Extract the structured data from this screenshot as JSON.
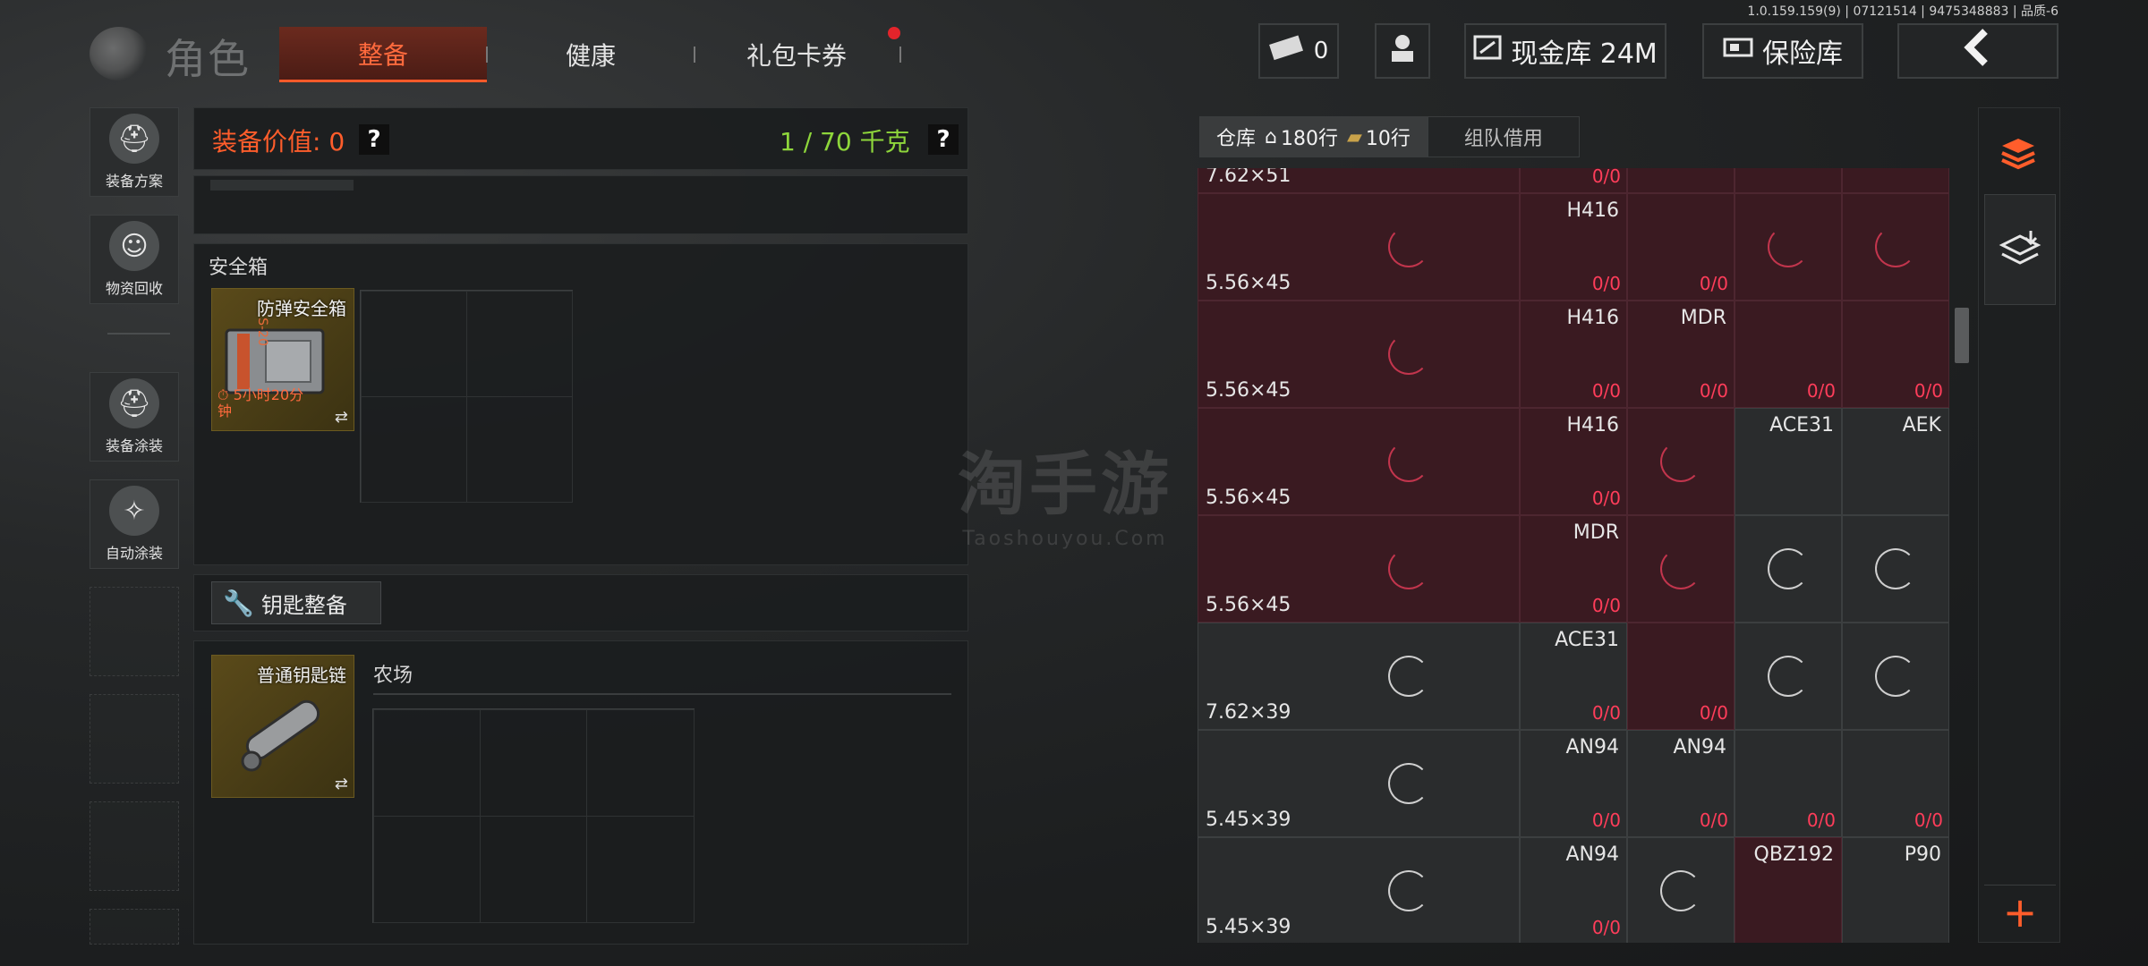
{
  "version": "1.0.159.159(9) | 07121514 | 9475348883 | 品质-6",
  "header": {
    "title": "角色",
    "tabs": [
      {
        "label": "整备",
        "active": true
      },
      {
        "label": "健康",
        "active": false
      },
      {
        "label": "礼包卡券",
        "active": false
      }
    ],
    "currency_count": "0",
    "cash_vault_label": "现金库 24M",
    "insurance_label": "保险库"
  },
  "sidebar": {
    "items": [
      {
        "label": "装备方案",
        "icon": "helmet-icon"
      },
      {
        "label": "物资回收",
        "icon": "recycle-icon"
      },
      {
        "label": "装备涂装",
        "icon": "paint-helmet-icon"
      },
      {
        "label": "自动涂装",
        "icon": "auto-paint-icon"
      }
    ]
  },
  "equipment": {
    "value_label": "装备价值: 0",
    "weight_label": "1 / 70 千克",
    "help": "?",
    "safebox_title": "安全箱",
    "safebox_item": {
      "name": "防弹安全箱",
      "timer": "5小时20分钟",
      "code": "S-20"
    },
    "key_section_label": "钥匙整备",
    "key_item": {
      "name": "普通钥匙链"
    },
    "key_map_label": "农场"
  },
  "watermark": {
    "big": "淘手游",
    "small": "Taoshouyou.Com"
  },
  "warehouse": {
    "tabs": [
      {
        "label": "仓库",
        "active": true
      },
      {
        "label": "180行",
        "active": true
      },
      {
        "label": "10行",
        "active": true
      },
      {
        "label": "组队借用",
        "active": false
      }
    ],
    "rows": [
      {
        "caliber": "7.62×51",
        "cells": [
          {
            "name": "",
            "count": "0/0",
            "state": "red"
          },
          {
            "name": "",
            "count": "",
            "state": "red"
          },
          {
            "name": "",
            "count": "",
            "state": "red"
          },
          {
            "name": "",
            "count": "",
            "state": "red"
          }
        ]
      },
      {
        "caliber": "5.56×45",
        "cells": [
          {
            "name": "H416",
            "count": "0/0",
            "state": "red"
          },
          {
            "name": "",
            "count": "0/0",
            "state": "red"
          },
          {
            "name": "",
            "count": "",
            "state": "red"
          },
          {
            "name": "",
            "count": "",
            "state": "red"
          }
        ]
      },
      {
        "caliber": "5.56×45",
        "cells": [
          {
            "name": "H416",
            "count": "0/0",
            "state": "red"
          },
          {
            "name": "MDR",
            "count": "0/0",
            "state": "red"
          },
          {
            "name": "",
            "count": "0/0",
            "state": "red"
          },
          {
            "name": "",
            "count": "0/0",
            "state": "red"
          }
        ]
      },
      {
        "caliber": "5.56×45",
        "cells": [
          {
            "name": "H416",
            "count": "0/0",
            "state": "red"
          },
          {
            "name": "",
            "count": "",
            "state": "red"
          },
          {
            "name": "ACE31",
            "count": "",
            "state": "gray"
          },
          {
            "name": "AEK",
            "count": "",
            "state": "gray"
          }
        ]
      },
      {
        "caliber": "5.56×45",
        "cells": [
          {
            "name": "MDR",
            "count": "0/0",
            "state": "red"
          },
          {
            "name": "",
            "count": "",
            "state": "red"
          },
          {
            "name": "",
            "count": "",
            "state": "gray"
          },
          {
            "name": "",
            "count": "",
            "state": "gray"
          }
        ]
      },
      {
        "caliber": "7.62×39",
        "cells": [
          {
            "name": "ACE31",
            "count": "0/0",
            "state": "gray"
          },
          {
            "name": "",
            "count": "0/0",
            "state": "red"
          },
          {
            "name": "",
            "count": "",
            "state": "gray"
          },
          {
            "name": "",
            "count": "",
            "state": "gray"
          }
        ]
      },
      {
        "caliber": "5.45×39",
        "cells": [
          {
            "name": "AN94",
            "count": "0/0",
            "state": "gray"
          },
          {
            "name": "AN94",
            "count": "0/0",
            "state": "gray"
          },
          {
            "name": "",
            "count": "0/0",
            "state": "gray"
          },
          {
            "name": "",
            "count": "0/0",
            "state": "gray"
          }
        ]
      },
      {
        "caliber": "5.45×39",
        "cells": [
          {
            "name": "AN94",
            "count": "0/0",
            "state": "gray"
          },
          {
            "name": "",
            "count": "",
            "state": "gray"
          },
          {
            "name": "QBZ192",
            "count": "",
            "state": "red"
          },
          {
            "name": "P90",
            "count": "",
            "state": "gray"
          }
        ]
      }
    ]
  },
  "colors": {
    "accent": "#ff5d2b",
    "weight_ok": "#8ed63b",
    "count_red": "#ff3d5a",
    "cell_red": "#3a1a21"
  }
}
